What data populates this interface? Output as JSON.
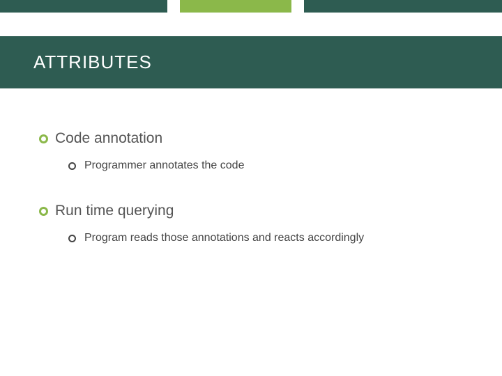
{
  "title": "ATTRIBUTES",
  "bullets": [
    {
      "label": "Code annotation",
      "children": [
        {
          "label": "Programmer annotates the code"
        }
      ]
    },
    {
      "label": "Run time querying",
      "children": [
        {
          "label": "Program reads those annotations and reacts accordingly"
        }
      ]
    }
  ]
}
